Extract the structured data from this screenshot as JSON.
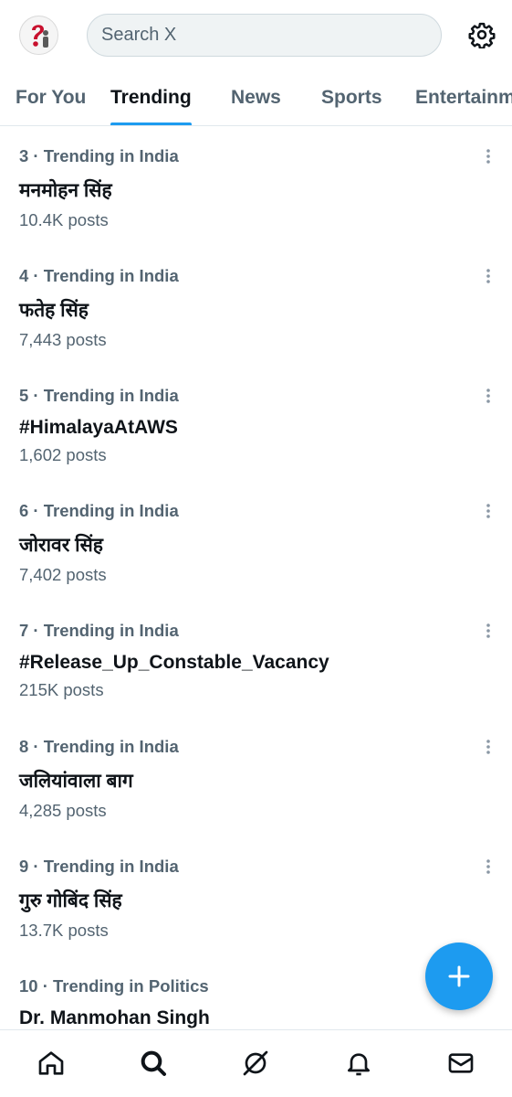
{
  "header": {
    "search_placeholder": "Search X"
  },
  "tabs": [
    {
      "label": "For You",
      "active": false
    },
    {
      "label": "Trending",
      "active": true
    },
    {
      "label": "News",
      "active": false
    },
    {
      "label": "Sports",
      "active": false
    },
    {
      "label": "Entertainment",
      "active": false
    }
  ],
  "trends": [
    {
      "context": "3 · Trending in India",
      "name": "मनमोहन सिंह",
      "posts": "10.4K posts"
    },
    {
      "context": "4 · Trending in India",
      "name": "फतेह सिंह",
      "posts": "7,443 posts"
    },
    {
      "context": "5 · Trending in India",
      "name": "#HimalayaAtAWS",
      "posts": "1,602 posts"
    },
    {
      "context": "6 · Trending in India",
      "name": "जोरावर सिंह",
      "posts": "7,402 posts"
    },
    {
      "context": "7 · Trending in India",
      "name": "#Release_Up_Constable_Vacancy",
      "posts": "215K posts"
    },
    {
      "context": "8 · Trending in India",
      "name": "जलियांवाला बाग",
      "posts": "4,285 posts"
    },
    {
      "context": "9 · Trending in India",
      "name": "गुरु गोबिंद सिंह",
      "posts": "13.7K posts"
    },
    {
      "context": "10 · Trending in Politics",
      "name": "Dr. Manmohan Singh",
      "posts": ""
    }
  ],
  "colors": {
    "accent": "#1d9bf0",
    "text_primary": "#0f1419",
    "text_secondary": "#536471"
  },
  "icons": {
    "header": [
      "profile-avatar",
      "settings-gear-icon"
    ],
    "bottom_nav": [
      "home-icon",
      "search-icon",
      "grok-icon",
      "notifications-bell-icon",
      "messages-mail-icon"
    ],
    "fab": "plus-icon"
  }
}
